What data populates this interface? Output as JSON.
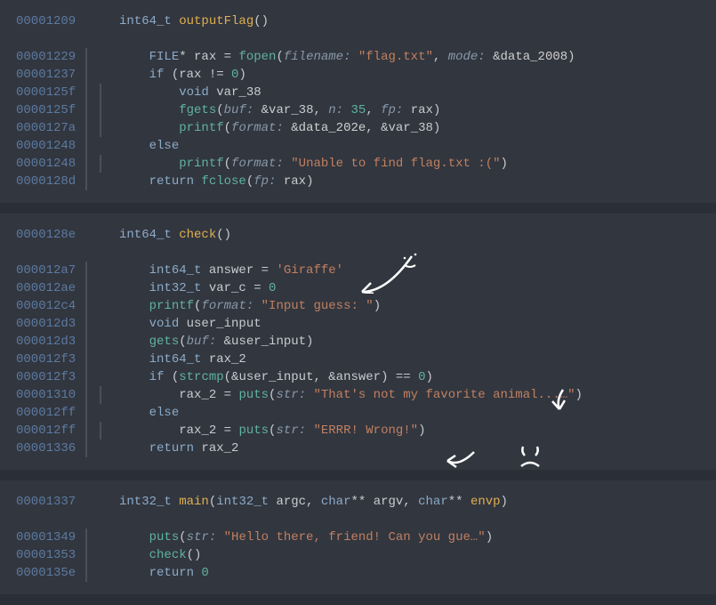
{
  "pane1": {
    "sig_addr": "00001209",
    "sig_type": "int64_t",
    "sig_name": "outputFlag",
    "lines": [
      {
        "addr": "00001229",
        "i": 1,
        "tokens": [
          [
            "type",
            "FILE"
          ],
          [
            "op",
            "* rax = "
          ],
          [
            "fn",
            "fopen"
          ],
          [
            "op",
            "("
          ],
          [
            "arg",
            "filename: "
          ],
          [
            "str",
            "\"flag.txt\""
          ],
          [
            "op",
            ", "
          ],
          [
            "arg",
            "mode: "
          ],
          [
            "op",
            "&"
          ],
          [
            "data",
            "data_2008"
          ],
          [
            "op",
            ")"
          ]
        ]
      },
      {
        "addr": "00001237",
        "i": 1,
        "tokens": [
          [
            "kw",
            "if "
          ],
          [
            "op",
            "(rax != "
          ],
          [
            "num",
            "0"
          ],
          [
            "op",
            ")"
          ]
        ]
      },
      {
        "addr": "0000125f",
        "i": 2,
        "tokens": [
          [
            "type",
            "void"
          ],
          [
            "var",
            " var_38"
          ]
        ]
      },
      {
        "addr": "0000125f",
        "i": 2,
        "tokens": [
          [
            "fn",
            "fgets"
          ],
          [
            "op",
            "("
          ],
          [
            "arg",
            "buf: "
          ],
          [
            "op",
            "&var_38, "
          ],
          [
            "arg",
            "n: "
          ],
          [
            "num",
            "35"
          ],
          [
            "op",
            ", "
          ],
          [
            "arg",
            "fp: "
          ],
          [
            "op",
            "rax)"
          ]
        ]
      },
      {
        "addr": "0000127a",
        "i": 2,
        "tokens": [
          [
            "fn",
            "printf"
          ],
          [
            "op",
            "("
          ],
          [
            "arg",
            "format: "
          ],
          [
            "op",
            "&"
          ],
          [
            "data",
            "data_202e"
          ],
          [
            "op",
            ", &var_38)"
          ]
        ]
      },
      {
        "addr": "00001248",
        "i": 1,
        "tokens": [
          [
            "kw",
            "else"
          ]
        ]
      },
      {
        "addr": "00001248",
        "i": 2,
        "tokens": [
          [
            "fn",
            "printf"
          ],
          [
            "op",
            "("
          ],
          [
            "arg",
            "format: "
          ],
          [
            "str",
            "\"Unable to find flag.txt :(\""
          ],
          [
            "op",
            ")"
          ]
        ]
      },
      {
        "addr": "0000128d",
        "i": 1,
        "tokens": [
          [
            "kw",
            "return "
          ],
          [
            "fn",
            "fclose"
          ],
          [
            "op",
            "("
          ],
          [
            "arg",
            "fp: "
          ],
          [
            "op",
            "rax)"
          ]
        ]
      }
    ]
  },
  "pane2": {
    "sig_addr": "0000128e",
    "sig_type": "int64_t",
    "sig_name": "check",
    "lines": [
      {
        "addr": "000012a7",
        "i": 1,
        "tokens": [
          [
            "type",
            "int64_t"
          ],
          [
            "var",
            " answer = "
          ],
          [
            "str",
            "'Giraffe'"
          ]
        ]
      },
      {
        "addr": "000012ae",
        "i": 1,
        "tokens": [
          [
            "type",
            "int32_t"
          ],
          [
            "var",
            " var_c = "
          ],
          [
            "num",
            "0"
          ]
        ]
      },
      {
        "addr": "000012c4",
        "i": 1,
        "tokens": [
          [
            "fn",
            "printf"
          ],
          [
            "op",
            "("
          ],
          [
            "arg",
            "format: "
          ],
          [
            "str",
            "\"Input guess: \""
          ],
          [
            "op",
            ")"
          ]
        ]
      },
      {
        "addr": "000012d3",
        "i": 1,
        "tokens": [
          [
            "type",
            "void"
          ],
          [
            "var",
            " user_input"
          ]
        ]
      },
      {
        "addr": "000012d3",
        "i": 1,
        "tokens": [
          [
            "fn",
            "gets"
          ],
          [
            "op",
            "("
          ],
          [
            "arg",
            "buf: "
          ],
          [
            "op",
            "&user_input)"
          ]
        ]
      },
      {
        "addr": "000012f3",
        "i": 1,
        "tokens": [
          [
            "type",
            "int64_t"
          ],
          [
            "var",
            " rax_2"
          ]
        ]
      },
      {
        "addr": "000012f3",
        "i": 1,
        "tokens": [
          [
            "kw",
            "if "
          ],
          [
            "op",
            "("
          ],
          [
            "fn",
            "strcmp"
          ],
          [
            "op",
            "(&user_input, &answer) == "
          ],
          [
            "num",
            "0"
          ],
          [
            "op",
            ")"
          ]
        ]
      },
      {
        "addr": "00001310",
        "i": 2,
        "tokens": [
          [
            "var",
            "rax_2 = "
          ],
          [
            "fn",
            "puts"
          ],
          [
            "op",
            "("
          ],
          [
            "arg",
            "str: "
          ],
          [
            "str",
            "\"That's not my favorite animal...…\""
          ],
          [
            "op",
            ")"
          ]
        ]
      },
      {
        "addr": "000012ff",
        "i": 1,
        "tokens": [
          [
            "kw",
            "else"
          ]
        ]
      },
      {
        "addr": "000012ff",
        "i": 2,
        "tokens": [
          [
            "var",
            "rax_2 = "
          ],
          [
            "fn",
            "puts"
          ],
          [
            "op",
            "("
          ],
          [
            "arg",
            "str: "
          ],
          [
            "str",
            "\"ERRR! Wrong!\""
          ],
          [
            "op",
            ")"
          ]
        ]
      },
      {
        "addr": "00001336",
        "i": 1,
        "tokens": [
          [
            "kw",
            "return "
          ],
          [
            "var",
            "rax_2"
          ]
        ]
      }
    ]
  },
  "pane3": {
    "sig_addr": "00001337",
    "sig_type": "int32_t",
    "sig_name": "main",
    "sig_args": [
      [
        "type",
        "int32_t"
      ],
      [
        "var",
        " argc, "
      ],
      [
        "type",
        "char"
      ],
      [
        "op",
        "** "
      ],
      [
        "var",
        "argv, "
      ],
      [
        "type",
        "char"
      ],
      [
        "op",
        "** "
      ],
      [
        "fnname",
        "envp"
      ]
    ],
    "lines": [
      {
        "addr": "00001349",
        "i": 1,
        "tokens": [
          [
            "fn",
            "puts"
          ],
          [
            "op",
            "("
          ],
          [
            "arg",
            "str: "
          ],
          [
            "str",
            "\"Hello there, friend! Can you gue…\""
          ],
          [
            "op",
            ")"
          ]
        ]
      },
      {
        "addr": "00001353",
        "i": 1,
        "tokens": [
          [
            "fn",
            "check"
          ],
          [
            "op",
            "()"
          ]
        ]
      },
      {
        "addr": "0000135e",
        "i": 1,
        "tokens": [
          [
            "kw",
            "return "
          ],
          [
            "num",
            "0"
          ]
        ]
      }
    ]
  }
}
